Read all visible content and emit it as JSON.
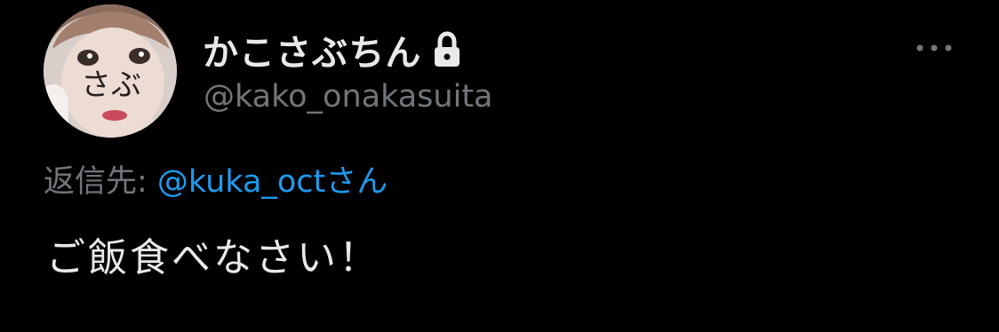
{
  "colors": {
    "background": "#000000",
    "primary_text": "#e7e9ea",
    "secondary_text": "#71767b",
    "link": "#1d9bf0"
  },
  "author": {
    "display_name": "かこさぶちん",
    "handle": "@kako_onakasuita",
    "protected_icon": "lock-icon",
    "avatar_text": "さぶ"
  },
  "more_button": {
    "icon": "more-horizontal-icon"
  },
  "reply": {
    "prefix": "返信先: ",
    "mention": "@kuka_oct",
    "suffix": "さん"
  },
  "tweet": {
    "text": "ご飯食べなさい！"
  }
}
